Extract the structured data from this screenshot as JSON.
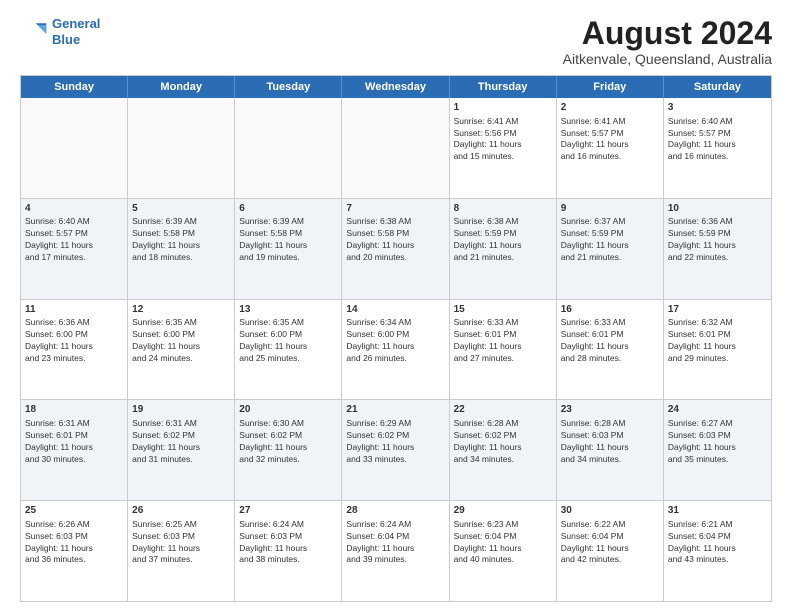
{
  "logo": {
    "line1": "General",
    "line2": "Blue"
  },
  "title": "August 2024",
  "location": "Aitkenvale, Queensland, Australia",
  "headers": [
    "Sunday",
    "Monday",
    "Tuesday",
    "Wednesday",
    "Thursday",
    "Friday",
    "Saturday"
  ],
  "rows": [
    {
      "alt": false,
      "cells": [
        {
          "day": "",
          "lines": []
        },
        {
          "day": "",
          "lines": []
        },
        {
          "day": "",
          "lines": []
        },
        {
          "day": "",
          "lines": []
        },
        {
          "day": "1",
          "lines": [
            "Sunrise: 6:41 AM",
            "Sunset: 5:56 PM",
            "Daylight: 11 hours",
            "and 15 minutes."
          ]
        },
        {
          "day": "2",
          "lines": [
            "Sunrise: 6:41 AM",
            "Sunset: 5:57 PM",
            "Daylight: 11 hours",
            "and 16 minutes."
          ]
        },
        {
          "day": "3",
          "lines": [
            "Sunrise: 6:40 AM",
            "Sunset: 5:57 PM",
            "Daylight: 11 hours",
            "and 16 minutes."
          ]
        }
      ]
    },
    {
      "alt": true,
      "cells": [
        {
          "day": "4",
          "lines": [
            "Sunrise: 6:40 AM",
            "Sunset: 5:57 PM",
            "Daylight: 11 hours",
            "and 17 minutes."
          ]
        },
        {
          "day": "5",
          "lines": [
            "Sunrise: 6:39 AM",
            "Sunset: 5:58 PM",
            "Daylight: 11 hours",
            "and 18 minutes."
          ]
        },
        {
          "day": "6",
          "lines": [
            "Sunrise: 6:39 AM",
            "Sunset: 5:58 PM",
            "Daylight: 11 hours",
            "and 19 minutes."
          ]
        },
        {
          "day": "7",
          "lines": [
            "Sunrise: 6:38 AM",
            "Sunset: 5:58 PM",
            "Daylight: 11 hours",
            "and 20 minutes."
          ]
        },
        {
          "day": "8",
          "lines": [
            "Sunrise: 6:38 AM",
            "Sunset: 5:59 PM",
            "Daylight: 11 hours",
            "and 21 minutes."
          ]
        },
        {
          "day": "9",
          "lines": [
            "Sunrise: 6:37 AM",
            "Sunset: 5:59 PM",
            "Daylight: 11 hours",
            "and 21 minutes."
          ]
        },
        {
          "day": "10",
          "lines": [
            "Sunrise: 6:36 AM",
            "Sunset: 5:59 PM",
            "Daylight: 11 hours",
            "and 22 minutes."
          ]
        }
      ]
    },
    {
      "alt": false,
      "cells": [
        {
          "day": "11",
          "lines": [
            "Sunrise: 6:36 AM",
            "Sunset: 6:00 PM",
            "Daylight: 11 hours",
            "and 23 minutes."
          ]
        },
        {
          "day": "12",
          "lines": [
            "Sunrise: 6:35 AM",
            "Sunset: 6:00 PM",
            "Daylight: 11 hours",
            "and 24 minutes."
          ]
        },
        {
          "day": "13",
          "lines": [
            "Sunrise: 6:35 AM",
            "Sunset: 6:00 PM",
            "Daylight: 11 hours",
            "and 25 minutes."
          ]
        },
        {
          "day": "14",
          "lines": [
            "Sunrise: 6:34 AM",
            "Sunset: 6:00 PM",
            "Daylight: 11 hours",
            "and 26 minutes."
          ]
        },
        {
          "day": "15",
          "lines": [
            "Sunrise: 6:33 AM",
            "Sunset: 6:01 PM",
            "Daylight: 11 hours",
            "and 27 minutes."
          ]
        },
        {
          "day": "16",
          "lines": [
            "Sunrise: 6:33 AM",
            "Sunset: 6:01 PM",
            "Daylight: 11 hours",
            "and 28 minutes."
          ]
        },
        {
          "day": "17",
          "lines": [
            "Sunrise: 6:32 AM",
            "Sunset: 6:01 PM",
            "Daylight: 11 hours",
            "and 29 minutes."
          ]
        }
      ]
    },
    {
      "alt": true,
      "cells": [
        {
          "day": "18",
          "lines": [
            "Sunrise: 6:31 AM",
            "Sunset: 6:01 PM",
            "Daylight: 11 hours",
            "and 30 minutes."
          ]
        },
        {
          "day": "19",
          "lines": [
            "Sunrise: 6:31 AM",
            "Sunset: 6:02 PM",
            "Daylight: 11 hours",
            "and 31 minutes."
          ]
        },
        {
          "day": "20",
          "lines": [
            "Sunrise: 6:30 AM",
            "Sunset: 6:02 PM",
            "Daylight: 11 hours",
            "and 32 minutes."
          ]
        },
        {
          "day": "21",
          "lines": [
            "Sunrise: 6:29 AM",
            "Sunset: 6:02 PM",
            "Daylight: 11 hours",
            "and 33 minutes."
          ]
        },
        {
          "day": "22",
          "lines": [
            "Sunrise: 6:28 AM",
            "Sunset: 6:02 PM",
            "Daylight: 11 hours",
            "and 34 minutes."
          ]
        },
        {
          "day": "23",
          "lines": [
            "Sunrise: 6:28 AM",
            "Sunset: 6:03 PM",
            "Daylight: 11 hours",
            "and 34 minutes."
          ]
        },
        {
          "day": "24",
          "lines": [
            "Sunrise: 6:27 AM",
            "Sunset: 6:03 PM",
            "Daylight: 11 hours",
            "and 35 minutes."
          ]
        }
      ]
    },
    {
      "alt": false,
      "cells": [
        {
          "day": "25",
          "lines": [
            "Sunrise: 6:26 AM",
            "Sunset: 6:03 PM",
            "Daylight: 11 hours",
            "and 36 minutes."
          ]
        },
        {
          "day": "26",
          "lines": [
            "Sunrise: 6:25 AM",
            "Sunset: 6:03 PM",
            "Daylight: 11 hours",
            "and 37 minutes."
          ]
        },
        {
          "day": "27",
          "lines": [
            "Sunrise: 6:24 AM",
            "Sunset: 6:03 PM",
            "Daylight: 11 hours",
            "and 38 minutes."
          ]
        },
        {
          "day": "28",
          "lines": [
            "Sunrise: 6:24 AM",
            "Sunset: 6:04 PM",
            "Daylight: 11 hours",
            "and 39 minutes."
          ]
        },
        {
          "day": "29",
          "lines": [
            "Sunrise: 6:23 AM",
            "Sunset: 6:04 PM",
            "Daylight: 11 hours",
            "and 40 minutes."
          ]
        },
        {
          "day": "30",
          "lines": [
            "Sunrise: 6:22 AM",
            "Sunset: 6:04 PM",
            "Daylight: 11 hours",
            "and 42 minutes."
          ]
        },
        {
          "day": "31",
          "lines": [
            "Sunrise: 6:21 AM",
            "Sunset: 6:04 PM",
            "Daylight: 11 hours",
            "and 43 minutes."
          ]
        }
      ]
    }
  ]
}
